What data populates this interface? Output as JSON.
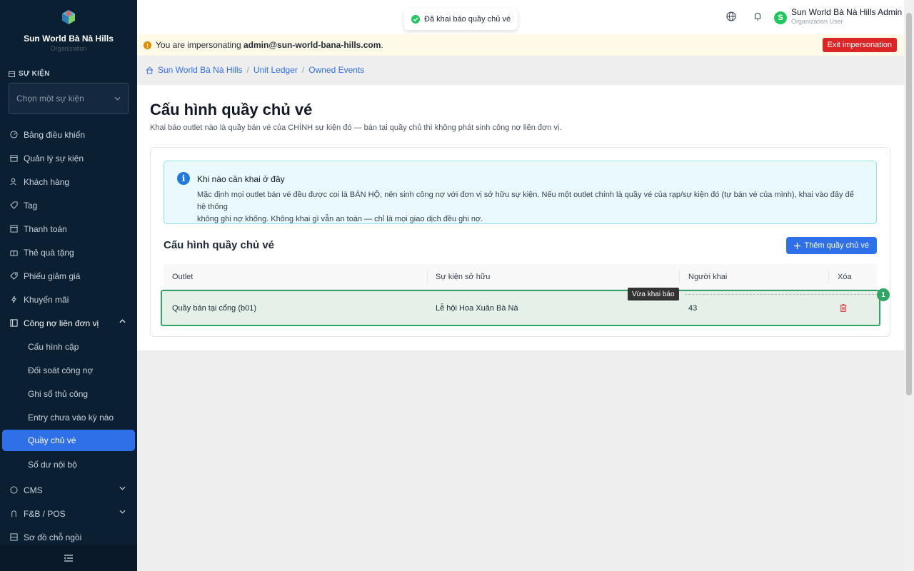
{
  "brand": {
    "name": "Sun World Bà Nà Hills",
    "sub": "Organization"
  },
  "sidebar": {
    "section_label": "SỰ KIỆN",
    "event_placeholder": "Chọn một sự kiện",
    "items": [
      {
        "label": "Bảng điều khiển",
        "icon": "dashboard-icon"
      },
      {
        "label": "Quản lý sự kiện",
        "icon": "calendar-icon"
      },
      {
        "label": "Khách hàng",
        "icon": "users-icon"
      },
      {
        "label": "Tag",
        "icon": "tag-icon"
      },
      {
        "label": "Thanh toán",
        "icon": "payment-icon"
      },
      {
        "label": "Thẻ quà tặng",
        "icon": "gift-icon"
      },
      {
        "label": "Phiếu giảm giá",
        "icon": "coupon-icon"
      },
      {
        "label": "Khuyến mãi",
        "icon": "promotion-icon"
      },
      {
        "label": "Công nợ liên đơn vị",
        "icon": "ledger-icon"
      }
    ],
    "sub_items": [
      "Cấu hình cặp",
      "Đối soát công nợ",
      "Ghi sổ thủ công",
      "Entry chưa vào kỳ nào",
      "Quầy chủ vé",
      "Số dư nội bộ"
    ],
    "bottom_items": [
      {
        "label": "CMS",
        "icon": "cms-icon"
      },
      {
        "label": "F&B / POS",
        "icon": "pos-icon"
      },
      {
        "label": "Sơ đồ chỗ ngồi",
        "icon": "seatmap-icon"
      }
    ]
  },
  "toast": {
    "text": "Đã khai báo quầy chủ vé"
  },
  "user": {
    "name": "Sun World Bà Nà Hills Admin",
    "role": "Organization User",
    "initial": "S"
  },
  "impersonation": {
    "prefix": "You are impersonating",
    "email": "admin@sun-world-bana-hills.com",
    "suffix": ".",
    "exit_label": "Exit impersonation"
  },
  "breadcrumbs": [
    "Sun World Bà Nà Hills",
    "Unit Ledger",
    "Owned Events"
  ],
  "page": {
    "title": "Cấu hình quầy chủ vé",
    "subtitle": "Khai báo outlet nào là quầy bán vé của CHÍNH sự kiện đó — bán tại quầy chủ thì không phát sinh công nợ liên đơn vị."
  },
  "info": {
    "title": "Khi nào cần khai ở đây",
    "line1": "Mặc định mọi outlet bán vé đều được coi là BÁN HỘ, nên sinh công nợ với đơn vị sở hữu sự kiện. Nếu một outlet chính là quầy vé của rạp/sự kiện đó (tự bán vé của mình), khai vào đây để hệ thống",
    "line2": "không ghi nợ khống. Không khai gì vẫn an toàn — chỉ là mọi giao dịch đều ghi nợ."
  },
  "section": {
    "title": "Cấu hình quầy chủ vé",
    "add_label": "Thêm quầy chủ vé"
  },
  "table": {
    "headers": [
      "Outlet",
      "Sự kiện sở hữu",
      "Người khai",
      "Xóa"
    ],
    "rows": [
      {
        "outlet": "Quầy bán tại cổng (b01)",
        "event": "Lễ hội Hoa Xuân Bà Nà",
        "declared_by": "43"
      }
    ]
  },
  "highlight": {
    "tooltip": "Vừa khai báo",
    "badge": "1"
  },
  "colors": {
    "sidebar": "#0b1f33",
    "accent": "#2f6fe8",
    "danger": "#dc2626",
    "success": "#34a466"
  }
}
